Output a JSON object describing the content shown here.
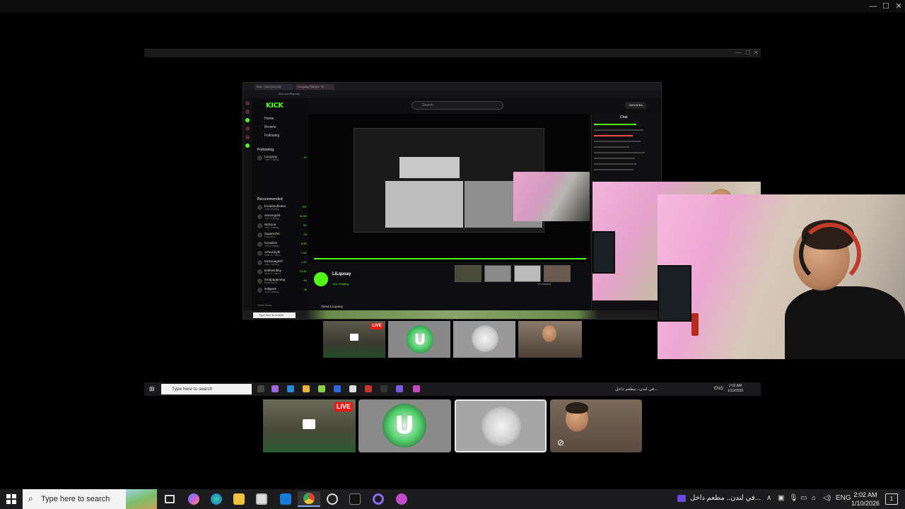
{
  "window_controls": {
    "minimize": "—",
    "maximize": "☐",
    "close": "✕"
  },
  "nested_browser": {
    "tabs": [
      "Kick - Get Chi's Vid",
      "LiLquasy Stream - Ki"
    ],
    "url": "kick.com/lilqusay",
    "search_placeholder": "Search",
    "get_kicks": "Get KICKs",
    "sidebar": {
      "logo": "KICK",
      "nav": [
        "Home",
        "Browse",
        "Following"
      ],
      "following_title": "Following",
      "following": [
        {
          "name": "LiLqusay",
          "sub": "Just Chatting",
          "count": "10"
        }
      ],
      "recommended_title": "Recommended",
      "recommended": [
        {
          "name": "breadandbutter",
          "sub": "Just Chatting",
          "count": "257"
        },
        {
          "name": "asmongold",
          "sub": "Just Chatting",
          "count": "11.9K"
        },
        {
          "name": "NickLea",
          "sub": "Just Chatting",
          "count": "5K"
        },
        {
          "name": "Squarnzhe",
          "sub": "Pummel 2",
          "count": "28"
        },
        {
          "name": "Kovutbot",
          "sub": "Just Chatting",
          "count": "5.6K"
        },
        {
          "name": "xxhnockyhl",
          "sub": "Slots & Casino",
          "count": "1.5K"
        },
        {
          "name": "McSavage87",
          "sub": "Just Chatting",
          "count": "1.2K"
        },
        {
          "name": "kebbinlobby",
          "sub": "Slots & Casino",
          "count": "13.9K"
        },
        {
          "name": "Smdpagaming",
          "sub": "Battlefield 6",
          "count": "63"
        },
        {
          "name": "ledlgeek",
          "sub": "Just Chatting",
          "count": "36"
        }
      ],
      "show_more": "Show More"
    },
    "streamer": {
      "name": "LiLqusay",
      "category": "Just Chatting",
      "viewers": "10 viewers"
    },
    "about": "About LiLqusay",
    "chat_title": "Chat",
    "inner_search": "Type here to search"
  },
  "thumbnails_small": {
    "live": "LIVE"
  },
  "inner_taskbar": {
    "search": "Type here to search",
    "news": "في لندن.. مطعم داخل...",
    "lang": "ENG",
    "time": "2:02 AM",
    "date": "1/10/2026"
  },
  "thumbnails_large": {
    "live": "LIVE"
  },
  "taskbar": {
    "search": "Type here to search",
    "news": "في لندن.. مطعم داخل...",
    "lang": "ENG",
    "time": "2:02 AM",
    "date": "1/10/2026",
    "notif": "1"
  },
  "colors": {
    "kick_green": "#53fc18",
    "live_red": "#e91916",
    "taskbar": "#1c1c1e"
  }
}
